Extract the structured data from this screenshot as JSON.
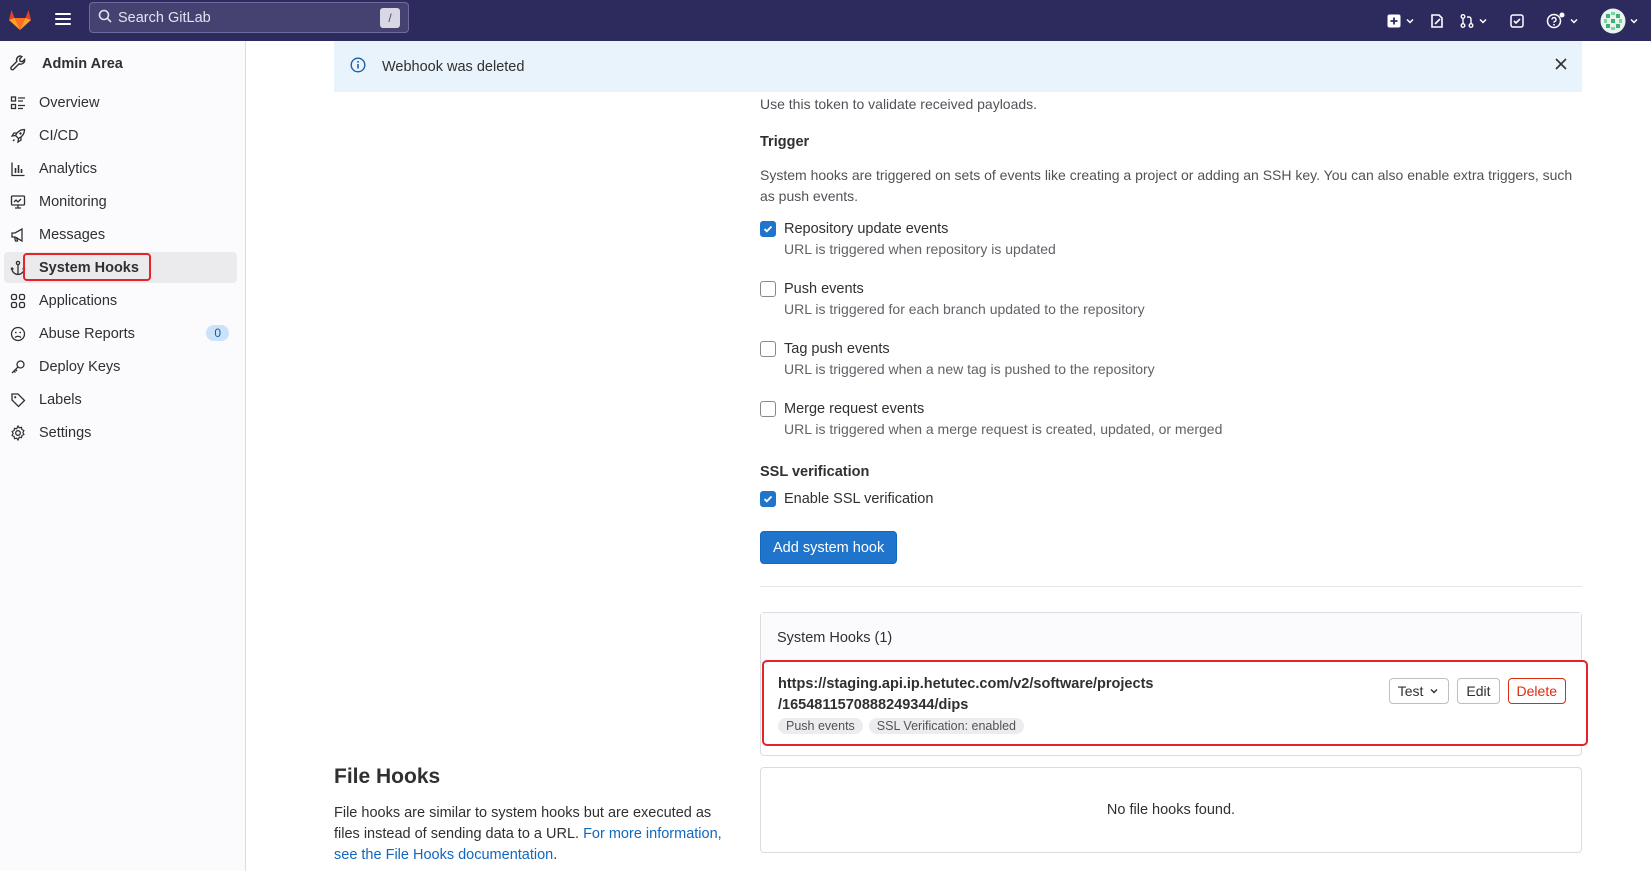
{
  "topbar": {
    "search_placeholder": "Search GitLab",
    "search_shortcut": "/",
    "icons": [
      "gitlab-logo",
      "menu-icon",
      "search-icon",
      "new-item-icon",
      "issues-icon",
      "merge-requests-icon",
      "todos-icon",
      "help-icon",
      "avatar"
    ]
  },
  "sidebar": {
    "title": "Admin Area",
    "items": [
      {
        "label": "Overview",
        "icon": "overview-icon"
      },
      {
        "label": "CI/CD",
        "icon": "rocket-icon"
      },
      {
        "label": "Analytics",
        "icon": "chart-icon"
      },
      {
        "label": "Monitoring",
        "icon": "monitor-icon"
      },
      {
        "label": "Messages",
        "icon": "bullhorn-icon"
      },
      {
        "label": "System Hooks",
        "icon": "anchor-icon",
        "active": true
      },
      {
        "label": "Applications",
        "icon": "applications-icon"
      },
      {
        "label": "Abuse Reports",
        "icon": "abuse-icon",
        "badge": "0"
      },
      {
        "label": "Deploy Keys",
        "icon": "key-icon"
      },
      {
        "label": "Labels",
        "icon": "label-icon"
      },
      {
        "label": "Settings",
        "icon": "settings-icon"
      }
    ]
  },
  "alert": {
    "message": "Webhook was deleted"
  },
  "form": {
    "token_help": "Use this token to validate received payloads.",
    "trigger_title": "Trigger",
    "trigger_desc": "System hooks are triggered on sets of events like creating a project or adding an SSH key. You can also enable extra triggers, such as push events.",
    "triggers": [
      {
        "label": "Repository update events",
        "desc": "URL is triggered when repository is updated",
        "checked": true
      },
      {
        "label": "Push events",
        "desc": "URL is triggered for each branch updated to the repository",
        "checked": false
      },
      {
        "label": "Tag push events",
        "desc": "URL is triggered when a new tag is pushed to the repository",
        "checked": false
      },
      {
        "label": "Merge request events",
        "desc": "URL is triggered when a merge request is created, updated, or merged",
        "checked": false
      }
    ],
    "ssl_title": "SSL verification",
    "ssl_label": "Enable SSL verification",
    "ssl_checked": true,
    "submit_label": "Add system hook"
  },
  "hooks_list": {
    "header": "System Hooks (1)",
    "hooks": [
      {
        "url_line1": "https://staging.api.ip.hetutec.com/v2/software/projects",
        "url_line2": "/1654811570888249344/dips",
        "tags": [
          "Push events",
          "SSL Verification: enabled"
        ],
        "test_label": "Test",
        "edit_label": "Edit",
        "delete_label": "Delete"
      }
    ]
  },
  "file_hooks": {
    "title": "File Hooks",
    "desc": "File hooks are similar to system hooks but are executed as files instead of sending data to a URL.",
    "link": "For more information, see the File Hooks documentation",
    "link_suffix": ".",
    "empty": "No file hooks found."
  }
}
